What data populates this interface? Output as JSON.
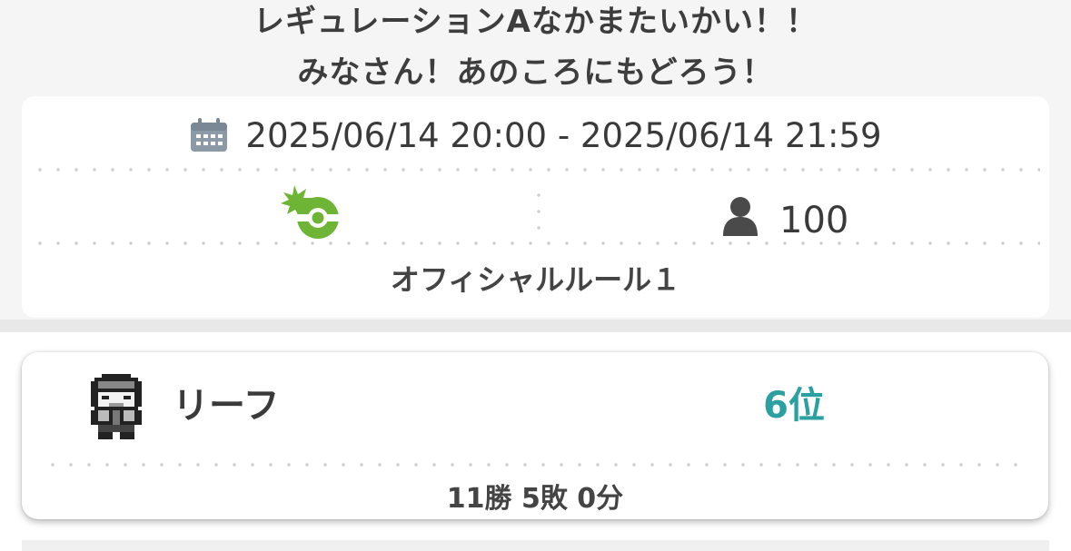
{
  "event": {
    "title_line1": "レギュレーションAなかまたいかい！！",
    "title_line2": "みなさん！あのころにもどろう！",
    "date_range": "2025/06/14 20:00 - 2025/06/14 21:59",
    "date_icon": "calendar-icon",
    "format_icon": "battle-format-icon",
    "participants_icon": "person-icon",
    "participants": "100",
    "rule": "オフィシャルルール１"
  },
  "result": {
    "avatar_icon": "trainer-avatar-icon",
    "player_name": "リーフ",
    "rank": "6位",
    "record": "11勝 5敗 0分"
  },
  "colors": {
    "rank": "#2aa0a0",
    "format_icon": "#6fb535",
    "icon_gray": "#5a5a5a",
    "calendar": "#8c9aa8"
  }
}
